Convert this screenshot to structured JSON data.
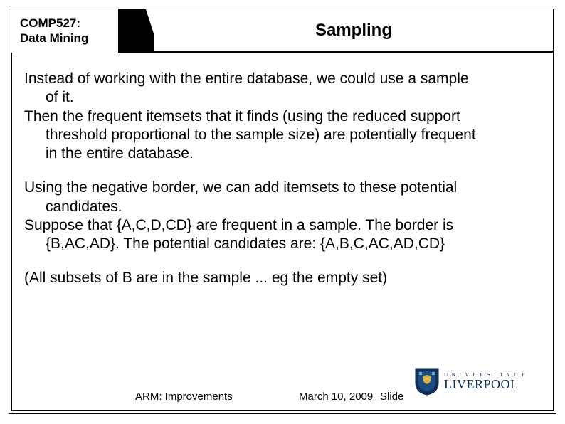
{
  "header": {
    "course_code": "COMP527:",
    "course_name": "Data Mining",
    "title": "Sampling"
  },
  "body": {
    "p1_line1": "Instead of working with the entire database, we could use a sample",
    "p1_line2": "of it.",
    "p2_line1": "Then the frequent itemsets that it finds (using the reduced support",
    "p2_line2": "threshold proportional to the sample size) are potentially frequent",
    "p2_line3": "in the entire database.",
    "p3_line1": "Using the negative border, we can add itemsets to these potential",
    "p3_line2": "candidates.",
    "p4_line1": "Suppose that {A,C,D,CD} are frequent in a sample.  The border is",
    "p4_line2": "{B,AC,AD}.  The potential candidates are: {A,B,C,AC,AD,CD}",
    "p5_line1": "(All subsets of B are in the sample ... eg the empty set)"
  },
  "footer": {
    "lecture": "ARM: Improvements",
    "date": "March 10, 2009",
    "slide_label": "Slide"
  },
  "logo": {
    "univ": "U N I V E R S I T Y   O F",
    "name": "LIVERPOOL"
  }
}
